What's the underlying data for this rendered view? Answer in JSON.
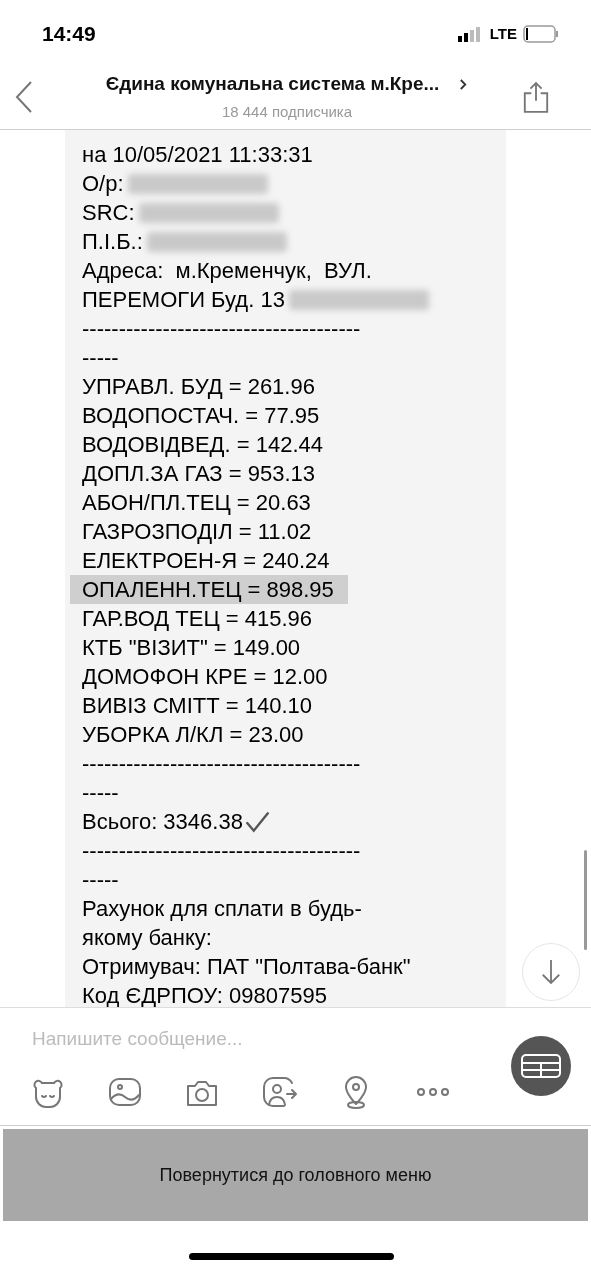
{
  "status_bar": {
    "time": "14:49",
    "network": "LTE"
  },
  "header": {
    "title": "Єдина комунальна система м.Кре...",
    "subtitle": "18 444 подписчика"
  },
  "message": {
    "lines": [
      {
        "kind": "text",
        "text": "на 10/05/2021 11:33:31",
        "redacted": false,
        "highlighted": false
      },
      {
        "kind": "text",
        "text": "О/р:",
        "redacted": true,
        "highlighted": false
      },
      {
        "kind": "text",
        "text": "SRC:",
        "redacted": true,
        "highlighted": false
      },
      {
        "kind": "text",
        "text": "П.І.Б.:",
        "redacted": true,
        "highlighted": false
      },
      {
        "kind": "text",
        "text": "Адреса:  м.Кременчук,  ВУЛ.",
        "redacted": false,
        "highlighted": false
      },
      {
        "kind": "text",
        "text": "ПЕРЕМОГИ Буд. 13",
        "redacted": true,
        "highlighted": false
      },
      {
        "kind": "text",
        "text": "--------------------------------------",
        "redacted": false,
        "highlighted": false
      },
      {
        "kind": "text",
        "text": "-----",
        "redacted": false,
        "highlighted": false
      },
      {
        "kind": "text",
        "text": "УПРАВЛ. БУД = 261.96",
        "redacted": false,
        "highlighted": false
      },
      {
        "kind": "text",
        "text": "ВОДОПОСТАЧ. = 77.95",
        "redacted": false,
        "highlighted": false
      },
      {
        "kind": "text",
        "text": "ВОДОВІДВЕД. = 142.44",
        "redacted": false,
        "highlighted": false
      },
      {
        "kind": "text",
        "text": "ДОПЛ.ЗА ГАЗ = 953.13",
        "redacted": false,
        "highlighted": false
      },
      {
        "kind": "text",
        "text": "АБОН/ПЛ.ТЕЦ = 20.63",
        "redacted": false,
        "highlighted": false
      },
      {
        "kind": "text",
        "text": "ГАЗРОЗПОДІЛ = 11.02",
        "redacted": false,
        "highlighted": false
      },
      {
        "kind": "text",
        "text": "ЕЛЕКТРОЕН-Я = 240.24",
        "redacted": false,
        "highlighted": false
      },
      {
        "kind": "text",
        "text": "ОПАЛЕНН.ТЕЦ = 898.95",
        "redacted": false,
        "highlighted": true
      },
      {
        "kind": "text",
        "text": "ГАР.ВОД ТЕЦ = 415.96",
        "redacted": false,
        "highlighted": false
      },
      {
        "kind": "text",
        "text": "КТБ \"ВІЗИТ\" = 149.00",
        "redacted": false,
        "highlighted": false
      },
      {
        "kind": "text",
        "text": "ДОМОФОН КРЕ = 12.00",
        "redacted": false,
        "highlighted": false
      },
      {
        "kind": "text",
        "text": "ВИВІЗ СМІТТ = 140.10",
        "redacted": false,
        "highlighted": false
      },
      {
        "kind": "text",
        "text": "УБОРКА Л/КЛ = 23.00",
        "redacted": false,
        "highlighted": false
      },
      {
        "kind": "text",
        "text": "--------------------------------------",
        "redacted": false,
        "highlighted": false
      },
      {
        "kind": "text",
        "text": "-----",
        "redacted": false,
        "highlighted": false
      },
      {
        "kind": "total",
        "text": "Всього: 3346.38",
        "redacted": false,
        "highlighted": false
      },
      {
        "kind": "text",
        "text": "--------------------------------------",
        "redacted": false,
        "highlighted": false
      },
      {
        "kind": "text",
        "text": "-----",
        "redacted": false,
        "highlighted": false
      },
      {
        "kind": "text",
        "text": "Рахунок для сплати в будь-",
        "redacted": false,
        "highlighted": false
      },
      {
        "kind": "text",
        "text": "якому банку:",
        "redacted": false,
        "highlighted": false
      },
      {
        "kind": "text",
        "text": "Отримувач: ПАТ \"Полтава-банк\"",
        "redacted": false,
        "highlighted": false
      },
      {
        "kind": "text",
        "text": "Код ЄДРПОУ: 09807595",
        "redacted": false,
        "highlighted": false
      }
    ]
  },
  "composer": {
    "placeholder": "Напишите сообщение..."
  },
  "main_menu_button": "Повернутися до головного меню"
}
